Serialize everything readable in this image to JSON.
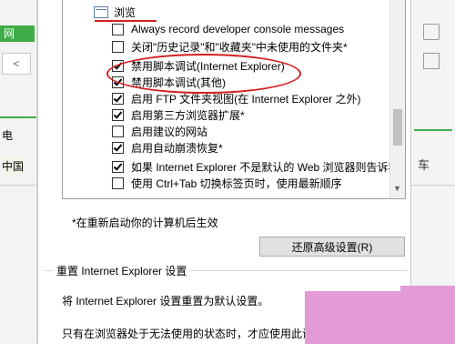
{
  "background": {
    "left_tab": "网",
    "left_box": "<",
    "left_text_1": "电",
    "left_text_2": "中国",
    "right_glyph": "车"
  },
  "settings_list": {
    "category": "浏览",
    "items": [
      {
        "label": "Always record developer console messages",
        "checked": false
      },
      {
        "label": "关闭\"历史记录\"和\"收藏夹\"中未使用的文件夹*",
        "checked": false
      },
      {
        "label": "禁用脚本调试(Internet Explorer)",
        "checked": true
      },
      {
        "label": "禁用脚本调试(其他)",
        "checked": true
      },
      {
        "label": "启用 FTP 文件夹视图(在 Internet Explorer 之外)",
        "checked": true
      },
      {
        "label": "启用第三方浏览器扩展*",
        "checked": true
      },
      {
        "label": "启用建议的网站",
        "checked": false
      },
      {
        "label": "启用自动崩溃恢复*",
        "checked": true
      },
      {
        "label": "如果 Internet Explorer 不是默认的 Web 浏览器则告诉我",
        "checked": true
      },
      {
        "label": "使用 Ctrl+Tab 切换标签页时，使用最新顺序",
        "checked": false
      }
    ]
  },
  "restart_note": "*在重新启动你的计算机后生效",
  "restore_button": "还原高级设置(R)",
  "reset_section": {
    "title": "重置 Internet Explorer 设置",
    "description": "将 Internet Explorer 设置重置为默认设置。",
    "note": "只有在浏览器处于无法使用的状态时，才应使用此设置。"
  },
  "colors": {
    "annotation_red": "#d42020",
    "brand_green": "#3fae49",
    "pink_overlay": "#e39ad6"
  }
}
